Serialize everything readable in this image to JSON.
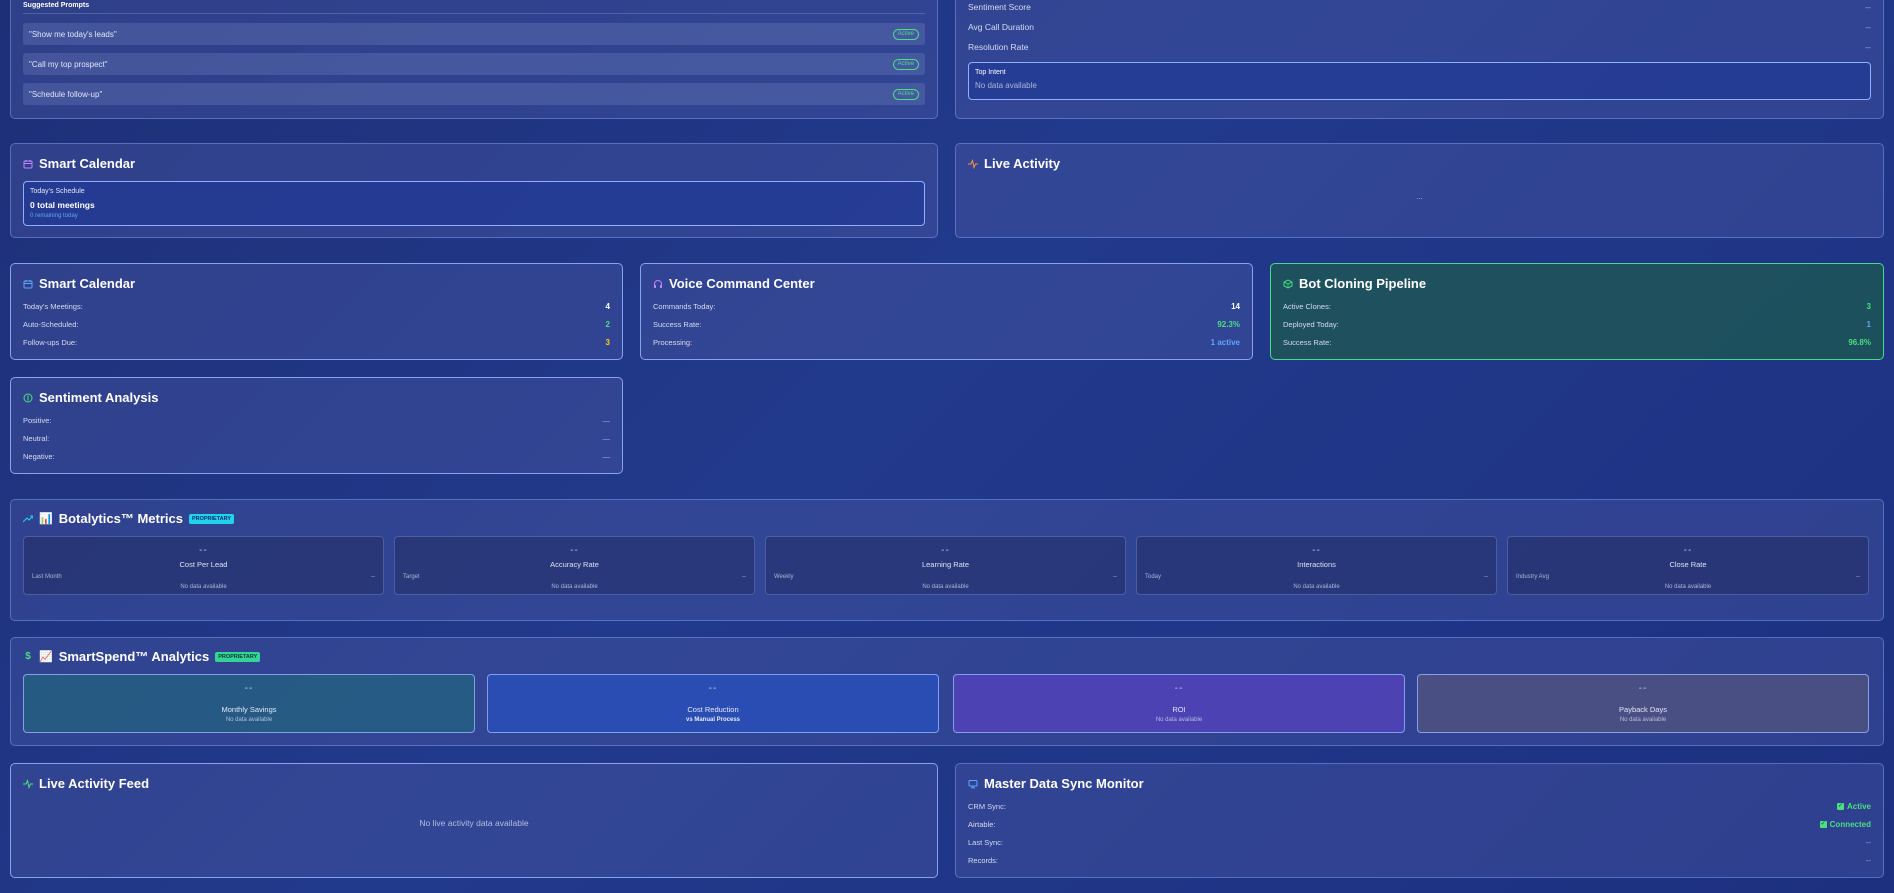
{
  "suggested_prompts": {
    "title": "Suggested Prompts",
    "items": [
      {
        "text": "\"Show me today's leads\"",
        "status": "Active"
      },
      {
        "text": "\"Call my top prospect\"",
        "status": "Active"
      },
      {
        "text": "\"Schedule follow-up\"",
        "status": "Active"
      }
    ]
  },
  "call_analytics": {
    "rows": [
      {
        "label": "Sentiment Score",
        "value": "--"
      },
      {
        "label": "Avg Call Duration",
        "value": "--"
      },
      {
        "label": "Resolution Rate",
        "value": "--"
      }
    ],
    "top_intent": {
      "label": "Top Intent",
      "value": "No data available"
    }
  },
  "smart_calendar_top": {
    "title": "Smart Calendar",
    "schedule_label": "Today's Schedule",
    "total": "0 total meetings",
    "remaining": "0 remaining today"
  },
  "live_activity": {
    "title": "Live Activity",
    "placeholder": "..."
  },
  "smart_calendar": {
    "title": "Smart Calendar",
    "rows": [
      {
        "label": "Today's Meetings:",
        "value": "4"
      },
      {
        "label": "Auto-Scheduled:",
        "value": "2"
      },
      {
        "label": "Follow-ups Due:",
        "value": "3"
      }
    ]
  },
  "voice_command": {
    "title": "Voice Command Center",
    "rows": [
      {
        "label": "Commands Today:",
        "value": "14"
      },
      {
        "label": "Success Rate:",
        "value": "92.3%"
      },
      {
        "label": "Processing:",
        "value": "1 active"
      }
    ]
  },
  "bot_cloning": {
    "title": "Bot Cloning Pipeline",
    "rows": [
      {
        "label": "Active Clones:",
        "value": "3"
      },
      {
        "label": "Deployed Today:",
        "value": "1"
      },
      {
        "label": "Success Rate:",
        "value": "96.8%"
      }
    ]
  },
  "sentiment": {
    "title": "Sentiment Analysis",
    "rows": [
      {
        "label": "Positive:",
        "value": "—"
      },
      {
        "label": "Neutral:",
        "value": "—"
      },
      {
        "label": "Negative:",
        "value": "—"
      }
    ]
  },
  "botalytics": {
    "emoji": "📊",
    "title": "Botalytics™ Metrics",
    "badge": "PROPRIETARY",
    "cards": [
      {
        "value": "--",
        "label": "Cost Per Lead",
        "sub": "Last Month",
        "sub_value": "--",
        "note": "No data available"
      },
      {
        "value": "--",
        "label": "Accuracy Rate",
        "sub": "Target",
        "sub_value": "--",
        "note": "No data available"
      },
      {
        "value": "--",
        "label": "Learning Rate",
        "sub": "Weekly",
        "sub_value": "--",
        "note": "No data available"
      },
      {
        "value": "--",
        "label": "Interactions",
        "sub": "Today",
        "sub_value": "--",
        "note": "No data available"
      },
      {
        "value": "--",
        "label": "Close Rate",
        "sub": "Industry Avg",
        "sub_value": "--",
        "note": "No data available"
      }
    ]
  },
  "smartspend": {
    "icon_glyph": "$",
    "emoji": "📈",
    "title": "SmartSpend™ Analytics",
    "badge": "PROPRIETARY",
    "cards": [
      {
        "value": "--",
        "label": "Monthly Savings",
        "sub": "No data available"
      },
      {
        "value": "--",
        "label": "Cost Reduction",
        "sub": "vs Manual Process"
      },
      {
        "value": "--",
        "label": "ROI",
        "sub": "No data available"
      },
      {
        "value": "--",
        "label": "Payback Days",
        "sub": "No data available"
      }
    ]
  },
  "activity_feed": {
    "title": "Live Activity Feed",
    "empty": "No live activity data available"
  },
  "data_sync": {
    "title": "Master Data Sync Monitor",
    "rows": [
      {
        "label": "CRM Sync:",
        "value": "Active"
      },
      {
        "label": "Airtable:",
        "value": "Connected"
      },
      {
        "label": "Last Sync:",
        "value": "--"
      },
      {
        "label": "Records:",
        "value": "--"
      }
    ]
  },
  "colors": {
    "accent_green": "#4ade80",
    "accent_blue": "#60a5fa",
    "accent_yellow": "#facc15",
    "badge_cyan": "#22d3ee"
  }
}
